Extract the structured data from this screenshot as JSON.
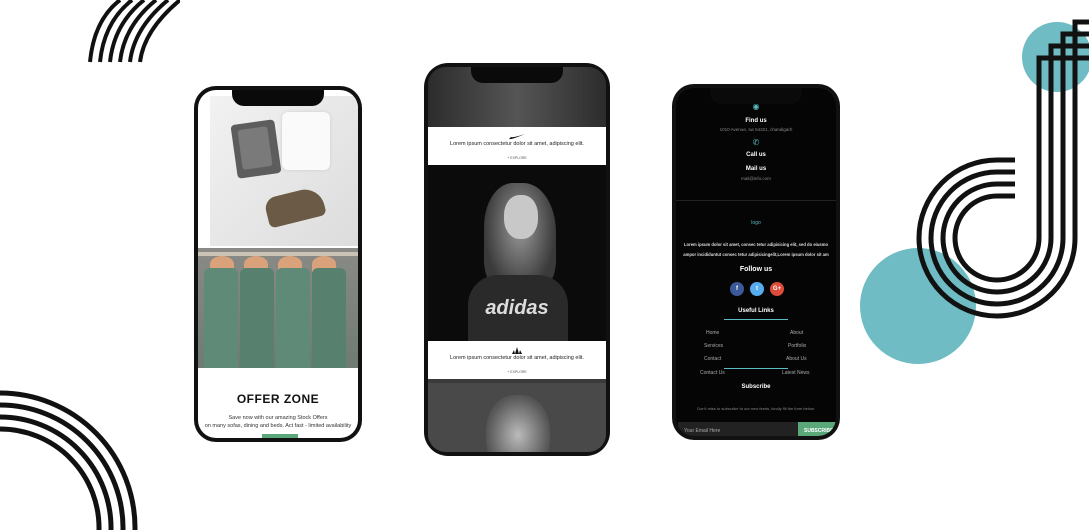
{
  "phone1": {
    "offer_title": "OFFER ZONE",
    "offer_line1": "Save now with our amazing Stock Offers",
    "offer_line2": "on many sofas, dining and beds. Act fast - limited availability"
  },
  "phone2": {
    "card1_text": "Lorem ipsum consectetur dolor sit amet, adipiscing elit.",
    "card1_link": "+ EXPLORE",
    "card2_text": "Lorem ipsum consectetur dolor sit amet, adipiscing elit.",
    "card2_link": "+ EXPLORE",
    "shirt_text": "adidas"
  },
  "phone3": {
    "find_us_title": "Find us",
    "find_us_address": "1010 Avenue, sw 54321, chandigarh",
    "call_us_title": "Call us",
    "mail_us_title": "Mail us",
    "mail_us_value": "mail@info.com",
    "logo_alt": "logo",
    "about_line1": "Lorem ipsum dolor sit amet, consec tetur adipisicing elit, sed do eiusmo",
    "about_line2": "ampor incididuntut consec tetur adipisicingelit,Lorem ipsum dolor sit am",
    "follow_title": "Follow us",
    "social": {
      "facebook": "f",
      "twitter": "t",
      "google": "G+",
      "facebook_color": "#3b5998",
      "twitter_color": "#55acee",
      "google_color": "#dd4b39"
    },
    "useful_links_title": "Useful Links",
    "links": [
      "Home",
      "About",
      "Services",
      "Portfolio",
      "Contact",
      "About Us",
      "Contact Us",
      "Latest News"
    ],
    "subscribe_title": "Subscribe",
    "subscribe_text": "Don't miss to subscribe to our new feeds, kindly fill the form below.",
    "email_placeholder": "Your Email Here",
    "subscribe_button": "SUBSCRIBE"
  },
  "colors": {
    "accent_teal": "#5bbcc4",
    "accent_green": "#5aa77a"
  }
}
